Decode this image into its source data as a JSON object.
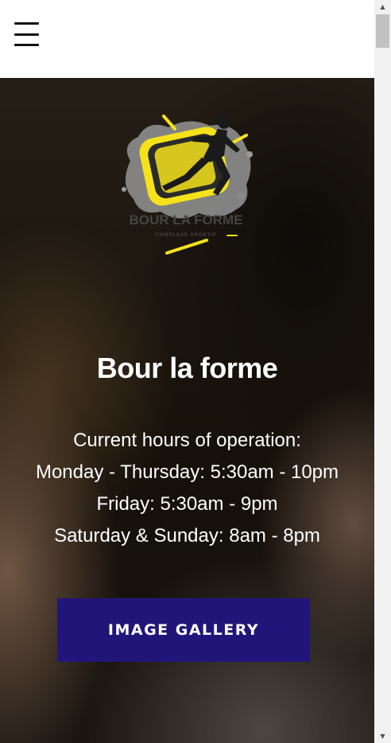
{
  "header": {
    "menu_icon": "hamburger-menu-icon"
  },
  "hero": {
    "logo": {
      "text": "BOUR LA FORME",
      "subtext": "COMPLEXE SPORTIF",
      "accent": "#f5e21b"
    },
    "title": "Bour la forme",
    "hours": [
      "Current hours of operation:",
      "Monday - Thursday: 5:30am - 10pm",
      "Friday: 5:30am - 9pm",
      "Saturday & Sunday: 8am - 8pm"
    ],
    "gallery_button": "IMAGE GALLERY",
    "button_color": "#22157a"
  },
  "scrollbar": {
    "up_icon": "scroll-up-arrow-icon",
    "down_icon": "scroll-down-arrow-icon"
  }
}
